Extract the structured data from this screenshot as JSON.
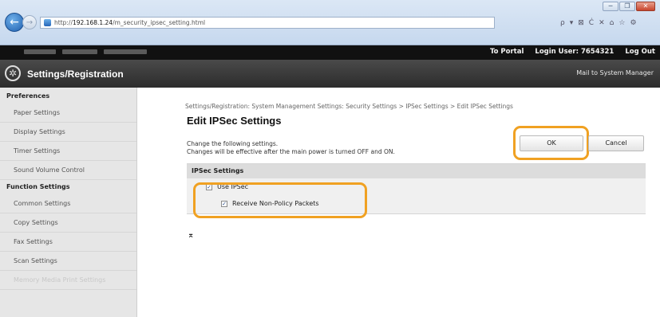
{
  "browser": {
    "url_prefix": "http://",
    "url_host": "192.168.1.24",
    "url_path": "/m_security_ipsec_setting.html",
    "search_icon": "search-icon",
    "address_tools": [
      "ρ",
      "▾",
      "⊠",
      "Ċ",
      "✕"
    ],
    "window_controls": [
      "─",
      "❐",
      "✕"
    ],
    "toolbar_icons": [
      "⌂",
      "☆",
      "⚙"
    ]
  },
  "header": {
    "to_portal": "To Portal",
    "login_user": "Login User:  7654321",
    "log_out": "Log Out",
    "app_title": "Settings/Registration",
    "mail_link": "Mail to System Manager"
  },
  "sidebar": {
    "preferences_heading": "Preferences",
    "preferences_items": [
      "Paper Settings",
      "Display Settings",
      "Timer Settings",
      "Sound Volume Control"
    ],
    "function_heading": "Function Settings",
    "function_items": [
      "Common Settings",
      "Copy Settings",
      "Fax Settings",
      "Scan Settings",
      "Memory Media Print Settings"
    ]
  },
  "main": {
    "breadcrumb": "Settings/Registration: System Management Settings: Security Settings > IPSec Settings > Edit IPSec Settings",
    "title": "Edit IPSec Settings",
    "desc_line1": "Change the following settings.",
    "desc_line2": "Changes will be effective after the main power is turned OFF and ON.",
    "ok_label": "OK",
    "cancel_label": "Cancel",
    "section_title": "IPSec Settings",
    "use_ipsec_label": "Use IPSec",
    "receive_label": "Receive Non-Policy Packets",
    "top_anchor": "⌅"
  },
  "colors": {
    "highlight": "#f0a122",
    "header_bg": "#111111",
    "sidebar_bg": "#e6e6e6"
  }
}
